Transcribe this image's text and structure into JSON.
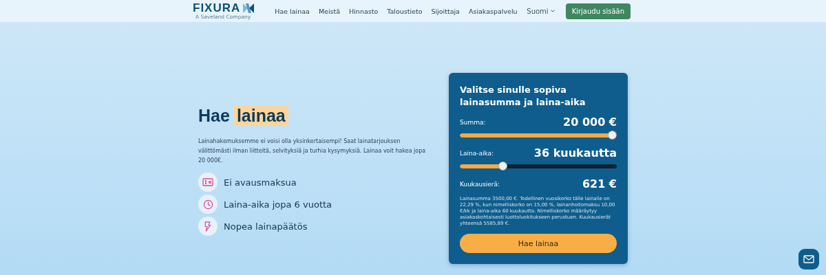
{
  "header": {
    "logo": "FIXURA",
    "tagline": "A Saveland Company",
    "nav": [
      "Hae lainaa",
      "Meistä",
      "Hinnasto",
      "Taloustieto",
      "Sijoittaja",
      "Asiakaspalvelu"
    ],
    "language": "Suomi",
    "login": "Kirjaudu sisään"
  },
  "hero": {
    "title_plain": "Hae",
    "title_highlight": "lainaa",
    "intro": "Lainahakemuksemme ei voisi olla yksinkertaisempi! Saat lainatarjouksen välittömästi ilman liitteitä, selvityksiä ja turhia kysymyksiä. Lainaa voit hakea jopa 20 000€.",
    "features": [
      {
        "kind": "money",
        "text": "Ei avausmaksua"
      },
      {
        "kind": "clock",
        "text": "Laina-aika jopa 6 vuotta"
      },
      {
        "kind": "bolt",
        "text": "Nopea lainapäätös"
      }
    ]
  },
  "calculator": {
    "title": "Valitse sinulle sopiva lainasumma ja laina-aika",
    "sliders": [
      {
        "label": "Summa:",
        "reading": "20 000 €",
        "level": 1.0
      },
      {
        "label": "Laina-aika:",
        "reading": "36 kuukautta",
        "level": 0.26
      }
    ],
    "monthly_label": "Kuukausierä:",
    "monthly_value": "621 €",
    "disclaimer": "Lainasumma 3500,00 €. Todellinen vuosikorko tälle lainalle on 22,29 %, kun nimelliskorko on 15,00 %, lainanhoitomaksu 10,00 €/kk ja laina-aika 60 kuukautta. Nimelliskorko määräytyy asiakaskohtaisesti luottoluokitukseen perustuen. Kuukausierät yhteensä 5585,89 €.",
    "button": "Hae lainaa"
  }
}
